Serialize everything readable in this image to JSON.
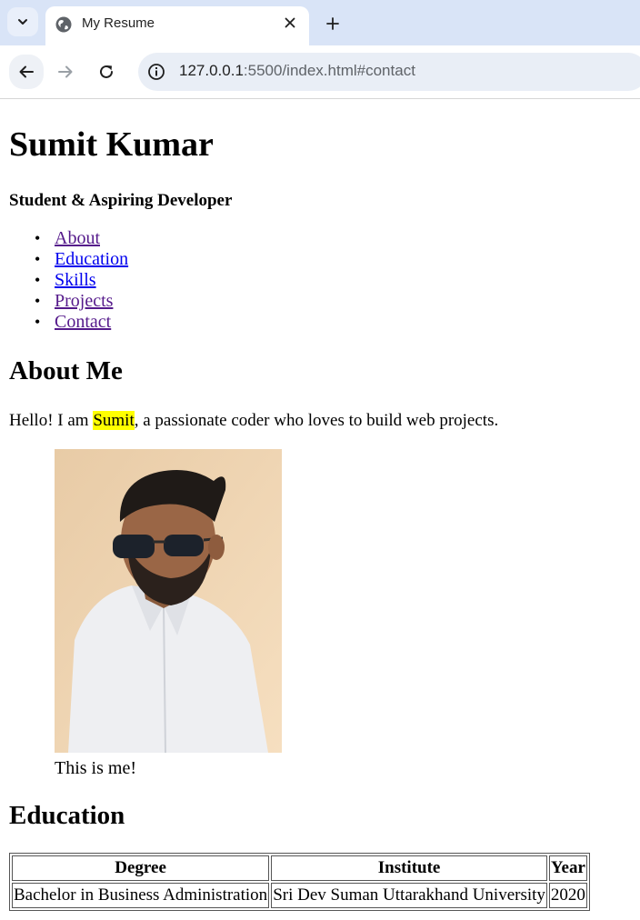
{
  "browser": {
    "tab_title": "My Resume",
    "url_host": "127.0.0.1",
    "url_rest": ":5500/index.html#contact"
  },
  "header": {
    "name": "Sumit Kumar",
    "tagline": "Student & Aspiring Developer"
  },
  "nav": {
    "items": [
      {
        "label": "About"
      },
      {
        "label": "Education"
      },
      {
        "label": "Skills"
      },
      {
        "label": "Projects"
      },
      {
        "label": "Contact"
      }
    ]
  },
  "about": {
    "heading": "About Me",
    "intro_before": "Hello! I am ",
    "intro_name": "Sumit",
    "intro_after": ", a passionate coder who loves to build web projects.",
    "caption": "This is me!"
  },
  "education": {
    "heading": "Education",
    "columns": [
      "Degree",
      "Institute",
      "Year"
    ],
    "rows": [
      [
        "Bachelor in Business Administration",
        "Sri Dev Suman Uttarakhand University",
        "2020"
      ]
    ]
  },
  "colors": {
    "highlight": "#ffff00",
    "link_visited": "#551a8b",
    "link_unvisited": "#0000ee",
    "tabbar_bg": "#d9e4f7"
  },
  "icons": [
    "tab-list-icon",
    "globe-icon",
    "close-icon",
    "plus-icon",
    "back-arrow-icon",
    "forward-arrow-icon",
    "reload-icon",
    "info-icon"
  ]
}
